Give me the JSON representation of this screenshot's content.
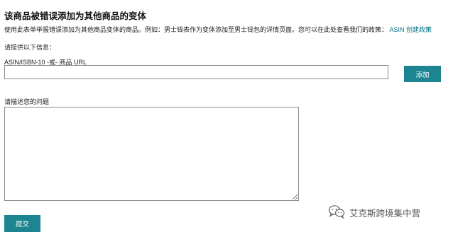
{
  "page": {
    "title": "该商品被错误添加为其他商品的变体",
    "description": "使用此表单举报错误添加为其他商品变体的商品。例如：男士钱表作为变体添加至男士钱包的详情页面。您可以在此处查看我们的政策：",
    "policy_link": "ASIN 创建政策",
    "prompt": "请提供以下信息：",
    "asin_label": "ASIN/ISBN-10 -或- 商品 URL",
    "asin_value": "",
    "add_button": "添加",
    "problem_label": "请描述您的问题",
    "problem_value": "",
    "submit_button": "提交"
  },
  "watermark": {
    "text": "艾克斯跨境集中营",
    "icon": "wechat-icon"
  },
  "colors": {
    "accent": "#1c8591",
    "link": "#007185"
  }
}
